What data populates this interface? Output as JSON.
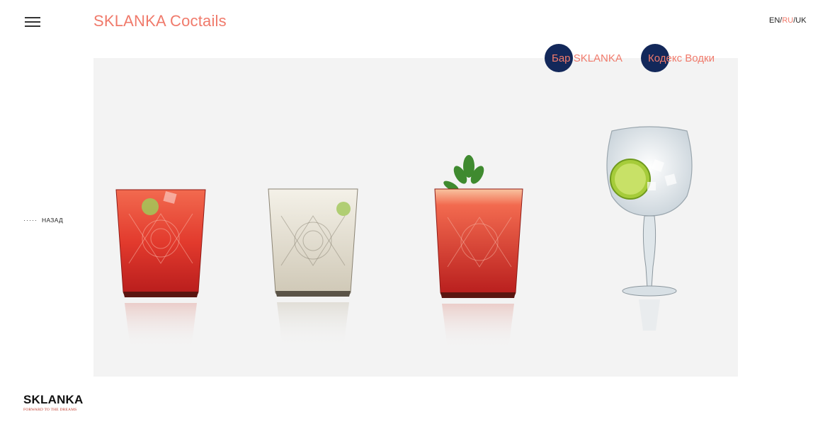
{
  "header": {
    "title": "SKLANKA Coctails",
    "lang": {
      "en": "EN",
      "ru": "RU",
      "uk": "UK",
      "sep": "/"
    }
  },
  "nav": {
    "bar_label": "Бар SKLANKA",
    "codex_label": "Кодекс Водки"
  },
  "back": {
    "label": "НАЗАД",
    "dots": "·····"
  },
  "footer": {
    "brand": "SKLANKA",
    "tagline": "FORWARD TO THE DREAMS"
  },
  "glasses": [
    {
      "name": "red-cocktail",
      "color": "#d9302a"
    },
    {
      "name": "clear-cocktail",
      "color": "#e8e3d6"
    },
    {
      "name": "red-mint-cocktail",
      "color": "#e0342a"
    },
    {
      "name": "gin-tonic-goblet",
      "color": "#dfe8ee"
    }
  ],
  "colors": {
    "accent": "#f07a6b",
    "navy": "#13285a",
    "stage": "#f3f3f3"
  }
}
